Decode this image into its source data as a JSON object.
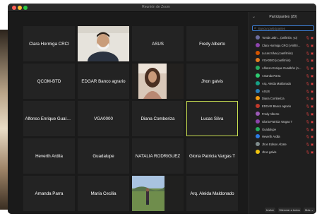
{
  "window": {
    "title": "Reunión de Zoom"
  },
  "gallery": {
    "tiles": [
      {
        "name": "Clara Hormiga CRCI",
        "type": "name"
      },
      {
        "name": "",
        "type": "video-man-mask"
      },
      {
        "name": "ASUS",
        "type": "name"
      },
      {
        "name": "Fredy Alberto",
        "type": "name"
      },
      {
        "name": "QCOM-BTD",
        "type": "name"
      },
      {
        "name": "EDGAR Banco agrario",
        "type": "name"
      },
      {
        "name": "",
        "type": "photo-woman"
      },
      {
        "name": "Jhon galvis",
        "type": "name"
      },
      {
        "name": "Alfonso Enrique Gualdr...",
        "type": "name"
      },
      {
        "name": "VGA0000",
        "type": "name"
      },
      {
        "name": "Diana Comberiza",
        "type": "name"
      },
      {
        "name": "Lucas Silva",
        "type": "name",
        "active": true
      },
      {
        "name": "Heverth Ardila",
        "type": "name"
      },
      {
        "name": "Guadalupe",
        "type": "name"
      },
      {
        "name": "NATALIA RODRIGUEZ",
        "type": "name"
      },
      {
        "name": "Gloria Patricia Vargas T",
        "type": "name"
      },
      {
        "name": "Amanda Parra",
        "type": "name"
      },
      {
        "name": "María Cecilia",
        "type": "name"
      },
      {
        "name": "",
        "type": "photo-outdoor"
      },
      {
        "name": "Arq. Aleida Maldonado",
        "type": "name"
      }
    ]
  },
  "participants": {
    "title": "Participantes (20)",
    "search_placeholder": "Buscar participantes",
    "list": [
      {
        "name": "Tomás Jalin... (anfitrión, yo)",
        "color": "#6d6d9e"
      },
      {
        "name": "Clara Hormiga CRCI (Anfitrión)",
        "color": "#8e44ad"
      },
      {
        "name": "Lucas Silva (coanfitrión)",
        "color": "#d35400"
      },
      {
        "name": "VGA0000 (coanfitrión)",
        "color": "#e67e22"
      },
      {
        "name": "Alfonso Enrique Gualdrón (A...",
        "color": "#27ae60"
      },
      {
        "name": "Amanda Parra",
        "color": "#2ecc71"
      },
      {
        "name": "Arq. Aleida Maldonado",
        "color": "#16a085"
      },
      {
        "name": "ASUS",
        "color": "#2980b9"
      },
      {
        "name": "Diana Comberiza",
        "color": "#f39c12"
      },
      {
        "name": "EDGAR Banco agrario",
        "color": "#c0392b"
      },
      {
        "name": "Fredy Alberto",
        "color": "#9b59b6"
      },
      {
        "name": "Gloria Patricia Vargas T",
        "color": "#8e44ad"
      },
      {
        "name": "Guadalupe",
        "color": "#27ae60"
      },
      {
        "name": "Heverth Ardila",
        "color": "#2c7be5"
      },
      {
        "name": "Jhon Edison Alzate",
        "color": "#7f8c8d"
      },
      {
        "name": "Jhon galvis",
        "color": "#f1c40f"
      }
    ],
    "invite_label": "Invitar",
    "mute_all_label": "Silenciar a todos",
    "more_label": "Más"
  }
}
